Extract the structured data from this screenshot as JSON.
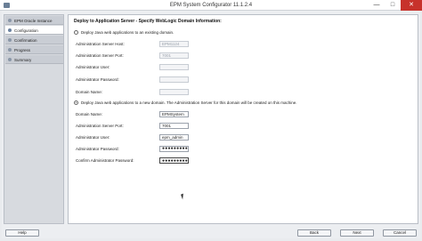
{
  "window": {
    "title": "EPM System Configurator 11.1.2.4",
    "controls": {
      "minimize": "—",
      "maximize": "□",
      "close": "✕"
    }
  },
  "sidebar": {
    "items": [
      {
        "label": "EPM Oracle Instance",
        "active": false
      },
      {
        "label": "Configuration",
        "active": true
      },
      {
        "label": "Confirmation",
        "active": false
      },
      {
        "label": "Progress",
        "active": false
      },
      {
        "label": "Summary",
        "active": false
      }
    ]
  },
  "main": {
    "section_title": "Deploy to Application Server - Specify WebLogic Domain Information:",
    "existing_domain": {
      "radio_label": "Deploy Java web applications to an existing domain.",
      "selected": false,
      "fields": [
        {
          "label": "Administration Server Host:",
          "value": "EPM1124",
          "disabled": true
        },
        {
          "label": "Administration Server Port:",
          "value": "7001",
          "disabled": true
        },
        {
          "label": "Administrator User:",
          "value": "",
          "disabled": true
        },
        {
          "label": "Administrator Password:",
          "value": "",
          "disabled": true
        },
        {
          "label": "Domain Name:",
          "value": "",
          "disabled": true
        }
      ]
    },
    "new_domain": {
      "radio_label": "Deploy Java web applications to a new domain. The Administration Server for this domain will be created on this machine.",
      "selected": true,
      "fields": [
        {
          "label": "Domain Name:",
          "value": "EPMSystem"
        },
        {
          "label": "Administration Server Port:",
          "value": "7001"
        },
        {
          "label": "Administrator User:",
          "value": "epm_admin"
        },
        {
          "label": "Administrator Password:",
          "value": "●●●●●●●●●"
        },
        {
          "label": "Confirm Administrator Password:",
          "value": "●●●●●●●●●"
        }
      ]
    }
  },
  "buttons": {
    "help": "Help",
    "back": "Back",
    "next": "Next",
    "cancel": "Cancel"
  }
}
